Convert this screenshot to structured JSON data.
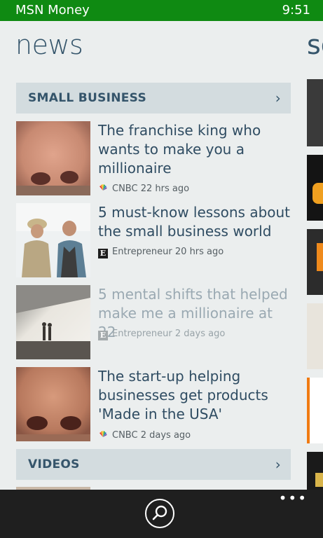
{
  "status_bar": {
    "app_name": "MSN Money",
    "time": "9:51"
  },
  "page": {
    "title": "news",
    "next_title": "so"
  },
  "sections": [
    {
      "title": "SMALL BUSINESS",
      "chevron": "›",
      "articles": [
        {
          "headline": "The franchise king who wants to make you a millionaire",
          "source": "CNBC",
          "age": "22 hrs ago",
          "read": false
        },
        {
          "headline": "5 must-know lessons about the small business world",
          "source": "Entrepreneur",
          "age": "20 hrs ago",
          "read": false
        },
        {
          "headline": "5 mental shifts that helped make me a millionaire at 22",
          "source": "Entrepreneur",
          "age": "2 days ago",
          "read": true
        },
        {
          "headline": "The start-up helping businesses get products 'Made in the USA'",
          "source": "CNBC",
          "age": "2 days ago",
          "read": false
        }
      ]
    },
    {
      "title": "VIDEOS",
      "chevron": "›"
    }
  ],
  "app_bar": {
    "search_icon": "search-icon",
    "more_label": "•••"
  },
  "colors": {
    "status_bar": "#0f8a12",
    "background": "#ebeeee",
    "section_header": "#d3dcdf",
    "headline": "#2f4c62",
    "read_headline": "#9aa9b2",
    "app_bar": "#1f1f1f"
  }
}
